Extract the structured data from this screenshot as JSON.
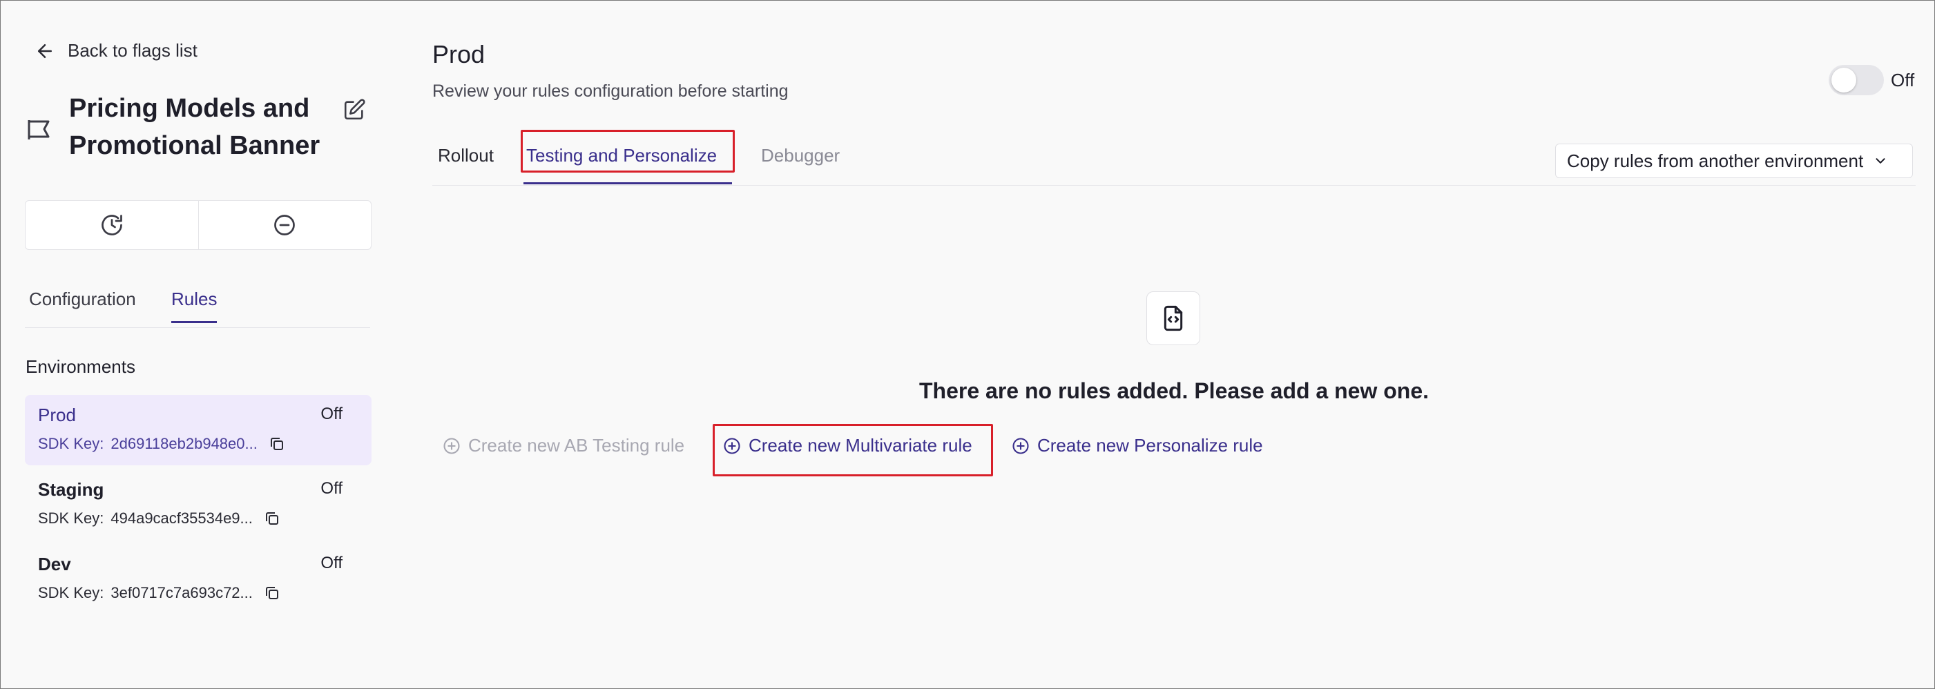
{
  "sidebar": {
    "back_label": "Back to flags list",
    "flag_title": "Pricing Models and Promotional Banner",
    "tabs": [
      {
        "label": "Configuration"
      },
      {
        "label": "Rules"
      }
    ],
    "environments_title": "Environments",
    "environments": [
      {
        "name": "Prod",
        "status": "Off",
        "key_label": "SDK Key:",
        "key": "2d69118eb2b948e0..."
      },
      {
        "name": "Staging",
        "status": "Off",
        "key_label": "SDK Key:",
        "key": "494a9cacf35534e9..."
      },
      {
        "name": "Dev",
        "status": "Off",
        "key_label": "SDK Key:",
        "key": "3ef0717c7a693c72..."
      }
    ]
  },
  "main": {
    "title": "Prod",
    "subtitle": "Review your rules configuration before starting",
    "toggle_label": "Off",
    "toggle_on": false,
    "tabs": [
      {
        "label": "Rollout"
      },
      {
        "label": "Testing and Personalize"
      },
      {
        "label": "Debugger"
      }
    ],
    "active_tab": "Testing and Personalize",
    "copy_dropdown_label": "Copy rules from another environment",
    "empty_message": "There are no rules added. Please add a new one.",
    "rule_buttons": {
      "ab": "Create new AB Testing rule",
      "multivariate": "Create new Multivariate rule",
      "personalize": "Create new Personalize rule"
    }
  },
  "colors": {
    "accent": "#3a2f8c",
    "active_env_bg": "#efeafc",
    "highlight": "#d8202a",
    "disabled": "#a8a8b2"
  },
  "icons": {
    "back": "arrow-left-icon",
    "flag": "flag-icon",
    "edit": "edit-icon",
    "history": "history-icon",
    "disable": "minus-circle-icon",
    "copy": "copy-icon",
    "dropdown": "chevron-down-icon",
    "empty": "file-code-icon",
    "add": "plus-circle-icon"
  }
}
